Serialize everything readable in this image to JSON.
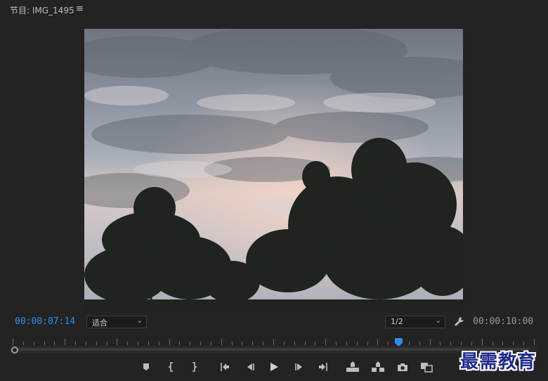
{
  "panel": {
    "title": "节目: IMG_1495",
    "menu_icon": "hamburger-menu-icon"
  },
  "viewer": {
    "content": "video-frame"
  },
  "status": {
    "current_timecode": "00:00:07:14",
    "duration_timecode": "00:00:10:00",
    "fit_select": "适合",
    "resolution_select": "1/2",
    "playhead_fraction": 0.74
  },
  "controls": [
    {
      "name": "add-marker-button",
      "icon": "marker-icon"
    },
    {
      "name": "mark-in-button",
      "icon": "mark-in-icon"
    },
    {
      "name": "mark-out-button",
      "icon": "mark-out-icon"
    },
    {
      "name": "go-to-in-button",
      "icon": "go-to-in-icon"
    },
    {
      "name": "step-back-button",
      "icon": "step-back-icon"
    },
    {
      "name": "play-button",
      "icon": "play-icon"
    },
    {
      "name": "step-forward-button",
      "icon": "step-forward-icon"
    },
    {
      "name": "go-to-out-button",
      "icon": "go-to-out-icon"
    },
    {
      "name": "lift-button",
      "icon": "lift-icon"
    },
    {
      "name": "extract-button",
      "icon": "extract-icon"
    },
    {
      "name": "export-frame-button",
      "icon": "camera-icon"
    },
    {
      "name": "comparison-view-button",
      "icon": "comparison-view-icon"
    }
  ],
  "watermark": "最需教育",
  "colors": {
    "background": "#232323",
    "timecode_active": "#2d8ceb",
    "playhead": "#2d8ceb"
  }
}
